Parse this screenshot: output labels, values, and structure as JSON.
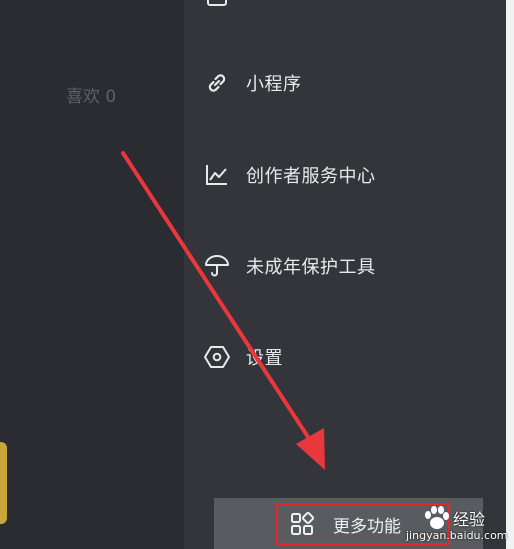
{
  "profile": {
    "likes_label": "喜欢 0"
  },
  "menu": {
    "items": [
      {
        "label": "小程序",
        "icon": "link-icon"
      },
      {
        "label": "创作者服务中心",
        "icon": "chart-icon"
      },
      {
        "label": "未成年保护工具",
        "icon": "umbrella-icon"
      },
      {
        "label": "设置",
        "icon": "hexagon-settings-icon"
      }
    ],
    "more_label": "更多功能",
    "more_icon": "grid-icon"
  },
  "watermark": {
    "title": "经验",
    "url": "jingyan.baidu.com"
  },
  "colors": {
    "drawer_bg": "#34353b",
    "left_bg": "#2b2c31",
    "highlight_box": "#e6262b",
    "arrow": "#e8383d",
    "accent_tab": "#c9a63a"
  }
}
